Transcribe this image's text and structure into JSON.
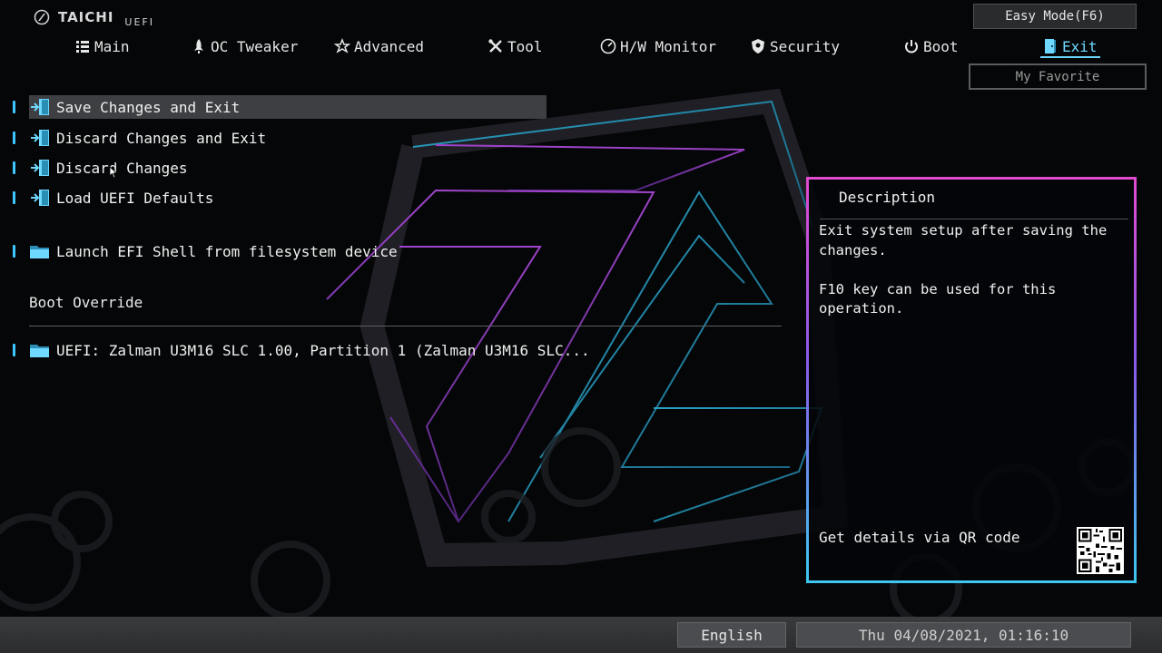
{
  "header": {
    "brand": "TAICHI",
    "brand_sub": "UEFI",
    "easy_mode_label": "Easy Mode(F6)",
    "my_favorite_label": "My Favorite"
  },
  "tabs": [
    {
      "label": "Main",
      "icon": "list-icon"
    },
    {
      "label": "OC Tweaker",
      "icon": "rocket-icon"
    },
    {
      "label": "Advanced",
      "icon": "star-icon"
    },
    {
      "label": "Tool",
      "icon": "tools-icon"
    },
    {
      "label": "H/W Monitor",
      "icon": "monitor-gauge-icon"
    },
    {
      "label": "Security",
      "icon": "shield-icon"
    },
    {
      "label": "Boot",
      "icon": "power-icon"
    },
    {
      "label": "Exit",
      "icon": "exit-door-icon",
      "active": true
    }
  ],
  "menu": {
    "items": [
      {
        "label": "Save Changes and Exit",
        "icon": "exit-door-icon",
        "selected": true
      },
      {
        "label": "Discard Changes and Exit",
        "icon": "exit-door-icon"
      },
      {
        "label": "Discard Changes",
        "icon": "exit-door-icon"
      },
      {
        "label": "Load UEFI Defaults",
        "icon": "exit-door-icon"
      },
      {
        "label": "Launch EFI Shell from filesystem device",
        "icon": "folder-icon"
      }
    ],
    "boot_override_label": "Boot Override",
    "boot_override_items": [
      {
        "label": "UEFI: Zalman U3M16 SLC 1.00, Partition 1 (Zalman U3M16 SLC...",
        "icon": "folder-icon"
      }
    ]
  },
  "description": {
    "title": "Description",
    "lines": [
      "Exit system setup after saving the changes.",
      "F10 key can be used for this operation."
    ],
    "qr_label": "Get details via QR code"
  },
  "footer": {
    "language": "English",
    "datetime": "Thu 04/08/2021, 01:16:10"
  },
  "colors": {
    "accent": "#6fd8ff",
    "selection": "#3d3f42",
    "panel_border_top": "#e04bd0",
    "panel_border_bottom": "#3fc6f0"
  }
}
